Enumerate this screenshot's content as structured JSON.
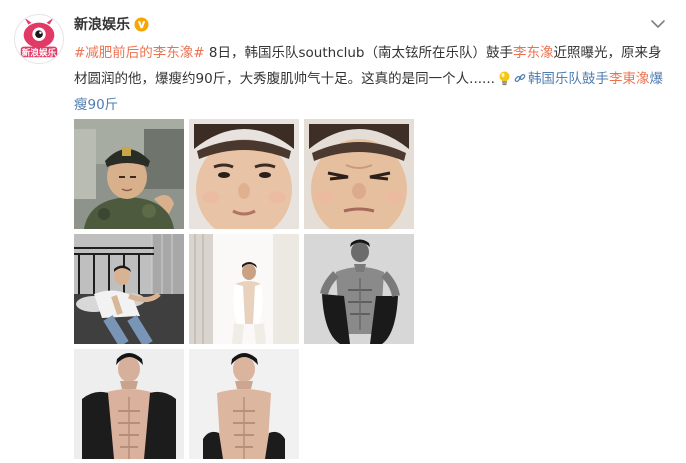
{
  "account": {
    "name": "新浪娱乐",
    "avatar_text": "新浪娱乐",
    "verified_icon": "verified-v-badge-icon",
    "menu_icon": "chevron-down-icon"
  },
  "post": {
    "topic_tag": "#减肥前后的李东潒#",
    "date_text": " 8日，韩国乐队southclub（南太铉所在乐队）鼓手",
    "mention_name": "李东潒",
    "body_text": "近照曝光，原来身材圆润的他，爆瘦约90斤，大秀腹肌帅气十足。这真的是同一个人......",
    "emoji_icon": "lightbulb-icon",
    "link_prefix": "韩国乐队鼓手",
    "link_highlight": "李東潒",
    "link_suffix": "爆瘦90斤",
    "link_icon": "link-icon"
  },
  "colors": {
    "topic": "#eb7350",
    "link": "#507daf",
    "text": "#333333",
    "verified": "#f7a500"
  },
  "photos": [
    {
      "id": "photo-1",
      "subject": "soldier-portrait"
    },
    {
      "id": "photo-2",
      "subject": "face-closeup"
    },
    {
      "id": "photo-3",
      "subject": "face-closeup-squint"
    },
    {
      "id": "photo-4",
      "subject": "man-on-bed"
    },
    {
      "id": "photo-5",
      "subject": "man-by-window"
    },
    {
      "id": "photo-6",
      "subject": "shirtless-bw"
    },
    {
      "id": "photo-7",
      "subject": "shirtless-jacket"
    },
    {
      "id": "photo-8",
      "subject": "shirtless-jacket-2"
    }
  ]
}
